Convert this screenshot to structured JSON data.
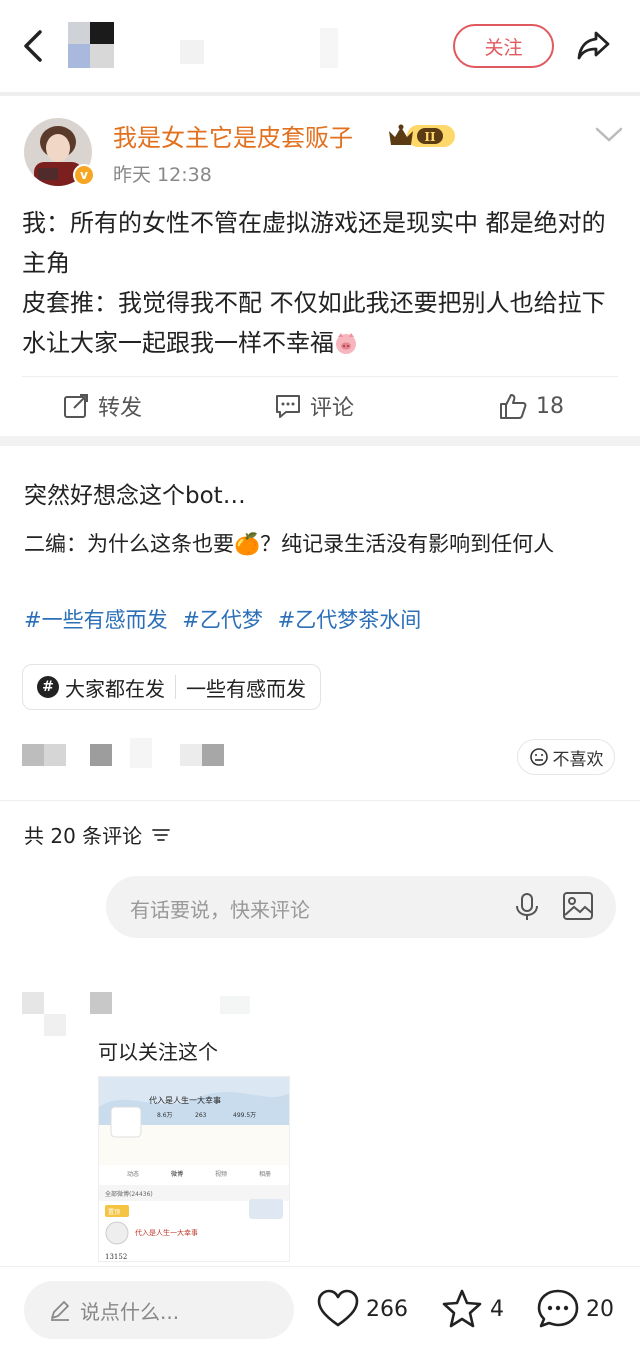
{
  "header": {
    "follow_label": "关注"
  },
  "repost": {
    "username": "我是女主它是皮套贩子",
    "level": "II",
    "time": "昨天 12:38",
    "text_line1": "我：所有的女性不管在虚拟游戏还是现实中 都是绝对的主角",
    "text_line2": "皮套推：我觉得我不配 不仅如此我还要把别人也给拉下水让大家一起跟我一样不幸福",
    "actions": {
      "repost": "转发",
      "comment": "评论",
      "like": "18"
    }
  },
  "post": {
    "title": "突然好想念这个bot…",
    "body": "二编：为什么这条也要🍊？纯记录生活没有影响到任何人",
    "tags": [
      "#一些有感而发",
      "#乙代梦",
      "#乙代梦茶水间"
    ],
    "topic_chip": {
      "left": "大家都在发",
      "right": "一些有感而发"
    },
    "dislike_label": "不喜欢"
  },
  "comments": {
    "count_label": "共 20 条评论",
    "input_placeholder": "有话要说，快来评论",
    "first_comment_text": "可以关注这个",
    "embedded": {
      "title": "代入是人生一大幸事",
      "stats": [
        "8.6万",
        "263",
        "499.5万"
      ],
      "tabs": [
        "动态",
        "微博",
        "视频",
        "相册"
      ],
      "filter": "全部微博(24436)",
      "pinned": "置顶",
      "entry_name": "代入是人生一大幸事",
      "number": "13152"
    }
  },
  "bottombar": {
    "say_placeholder": "说点什么...",
    "likes": "266",
    "favorites": "4",
    "comments": "20"
  },
  "colors": {
    "accent_red": "#e0595e",
    "username_orange": "#e2711f",
    "tag_blue": "#2b6fb8"
  }
}
